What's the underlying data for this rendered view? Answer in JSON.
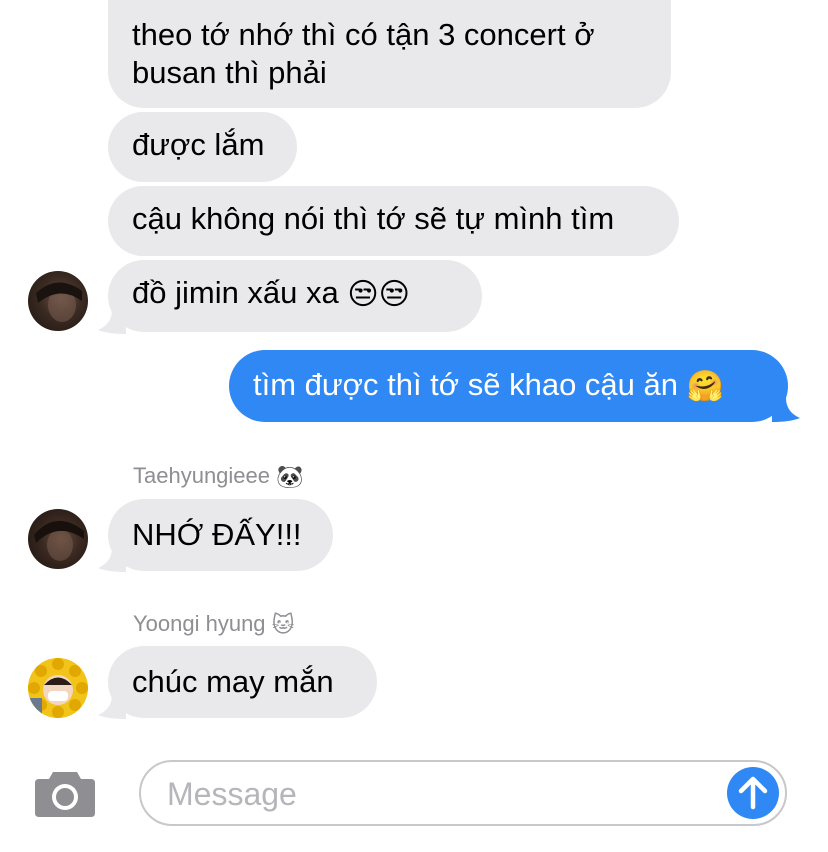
{
  "messages": [
    {
      "id": "m1",
      "direction": "incoming",
      "lines": [
        "theo tớ nhớ thì có tận 3 concert ở",
        "busan thì phải"
      ]
    },
    {
      "id": "m2",
      "direction": "incoming",
      "text": "được lắm"
    },
    {
      "id": "m3",
      "direction": "incoming",
      "text": "cậu không nói thì tớ sẽ tự mình tìm"
    },
    {
      "id": "m4",
      "direction": "incoming",
      "text": "đồ jimin xấu xa",
      "emoji": "😒😒"
    },
    {
      "id": "m5",
      "direction": "outgoing",
      "text": "tìm được thì tớ sẽ khao cậu ăn",
      "emoji": "🤗"
    },
    {
      "id": "m6",
      "direction": "incoming",
      "sender": "Taehyungieee",
      "sender_emoji": "🐼",
      "text": "NHỚ ĐẤY!!!"
    },
    {
      "id": "m7",
      "direction": "incoming",
      "sender": "Yoongi hyung",
      "sender_emoji": "🐱",
      "text": "chúc may mắn"
    }
  ],
  "composer": {
    "placeholder": "Message",
    "camera_icon": "camera-icon",
    "send_icon": "arrow-up-icon"
  },
  "colors": {
    "incoming_bubble": "#e9e9eb",
    "outgoing_bubble": "#2f88f4",
    "send_button": "#2f88f4"
  }
}
